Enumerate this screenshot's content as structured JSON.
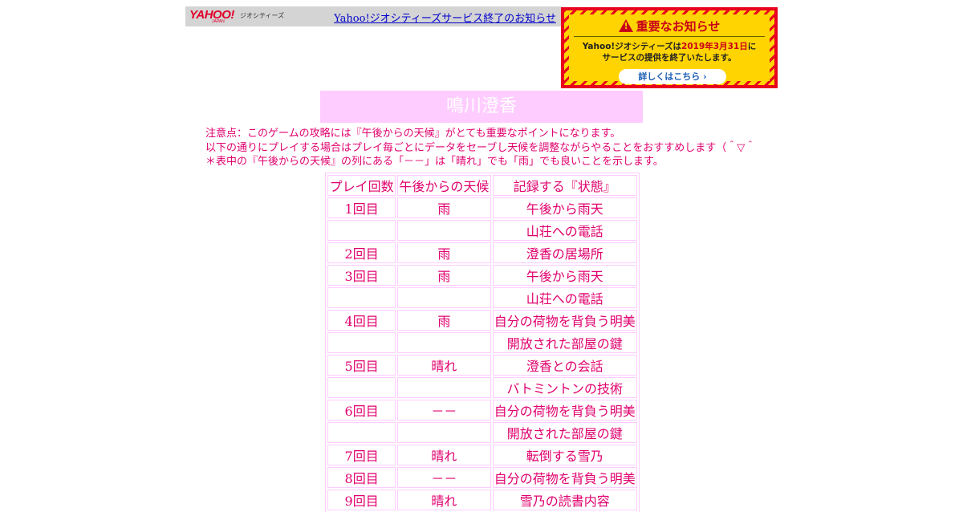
{
  "geocities_bar": {
    "logo": "YAHOO!",
    "logo_sub": "JAPAN",
    "brand": "ジオシティーズ",
    "link": "Yahoo!ジオシティーズサービス終了のお知らせ"
  },
  "notice": {
    "title": "重要なお知らせ",
    "line1_prefix": "Yahoo!ジオシティーズは",
    "line1_date": "2019年3月31日",
    "line1_suffix": "に",
    "line2": "サービスの提供を終了いたします。",
    "button": "詳しくはこちら ›",
    "icon": "warning-icon",
    "colors": {
      "border": "#e8001c",
      "background": "#ffd400",
      "title": "#c8001a",
      "link": "#1e5fb4"
    }
  },
  "page": {
    "title": "鳴川澄香",
    "notes": [
      "注意点：このゲームの攻略には『午後からの天候』がとても重要なポイントになります。",
      "以下の通りにプレイする場合はプレイ毎ごとにデータをセーブし天候を調整ながらやることをおすすめします（＾▽＾",
      "＊表中の『午後からの天候』の列にある「－－」は「晴れ」でも「雨」でも良いことを示します。"
    ],
    "colors": {
      "text": "#e0006e",
      "title_bg": "#ffccff",
      "border": "#ffccff"
    }
  },
  "table": {
    "headers": [
      "プレイ回数",
      "午後からの天候",
      "記録する『状態』"
    ],
    "rows": [
      [
        "1回目",
        "雨",
        "午後から雨天"
      ],
      [
        "",
        "",
        "山荘への電話"
      ],
      [
        "2回目",
        "雨",
        "澄香の居場所"
      ],
      [
        "3回目",
        "雨",
        "午後から雨天"
      ],
      [
        "",
        "",
        "山荘への電話"
      ],
      [
        "4回目",
        "雨",
        "自分の荷物を背負う明美"
      ],
      [
        "",
        "",
        "開放された部屋の鍵"
      ],
      [
        "5回目",
        "晴れ",
        "澄香との会話"
      ],
      [
        "",
        "",
        "バトミントンの技術"
      ],
      [
        "6回目",
        "－－",
        "自分の荷物を背負う明美"
      ],
      [
        "",
        "",
        "開放された部屋の鍵"
      ],
      [
        "7回目",
        "晴れ",
        "転倒する雪乃"
      ],
      [
        "8回目",
        "－－",
        "自分の荷物を背負う明美"
      ],
      [
        "9回目",
        "晴れ",
        "雪乃の読書内容"
      ]
    ]
  }
}
